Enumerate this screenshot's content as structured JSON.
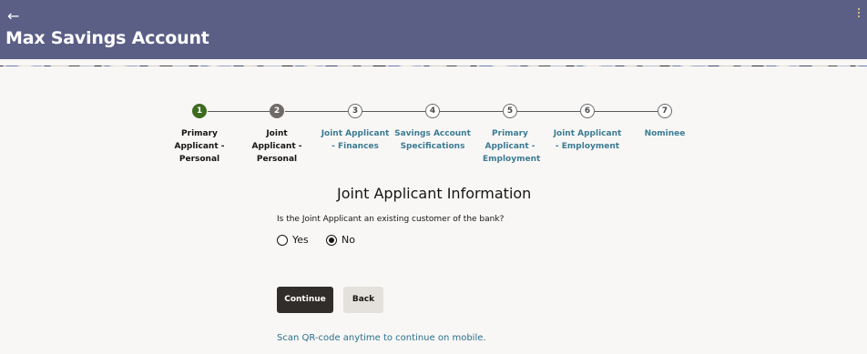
{
  "header": {
    "title": "Max Savings Account",
    "back_icon": "arrow-left-icon",
    "menu_icon": "more-vertical-icon",
    "bg_color": "#5b5f86"
  },
  "stepper": {
    "steps": [
      {
        "number": "1",
        "label": "Primary Applicant - Personal",
        "status": "completed"
      },
      {
        "number": "2",
        "label": "Joint Applicant - Personal",
        "status": "current"
      },
      {
        "number": "3",
        "label": "Joint Applicant - Finances",
        "status": "pending"
      },
      {
        "number": "4",
        "label": "Savings Account Specifications",
        "status": "pending"
      },
      {
        "number": "5",
        "label": "Primary Applicant - Employment",
        "status": "pending"
      },
      {
        "number": "6",
        "label": "Joint Applicant - Employment",
        "status": "pending"
      },
      {
        "number": "7",
        "label": "Nominee",
        "status": "pending"
      }
    ],
    "completed_color": "#3d6b1f",
    "link_color": "#3c7b94"
  },
  "form": {
    "section_title": "Joint Applicant Information",
    "question": "Is the Joint Applicant an existing customer of the bank?",
    "options": [
      {
        "label": "Yes",
        "selected": false
      },
      {
        "label": "No",
        "selected": true
      }
    ]
  },
  "actions": {
    "continue_label": "Continue",
    "back_label": "Back"
  },
  "footer": {
    "qr_text": "Scan QR-code anytime to continue on mobile."
  }
}
